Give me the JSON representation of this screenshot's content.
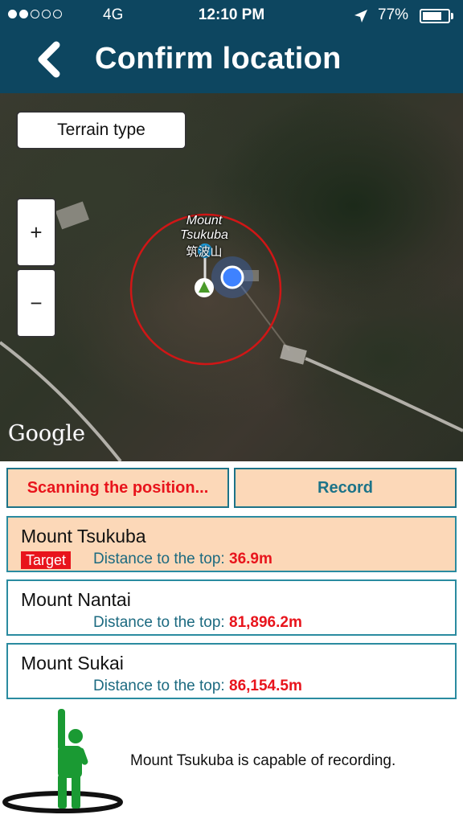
{
  "status_bar": {
    "carrier": "4G",
    "time": "12:10 PM",
    "battery_percent": "77%",
    "battery_level": 0.77,
    "signal_bars_filled": 2,
    "signal_bars_total": 5
  },
  "header": {
    "title": "Confirm location",
    "back_icon": "chevron-left-icon",
    "background_color": "#0d4660"
  },
  "map": {
    "terrain_button_label": "Terrain type",
    "zoom_in_label": "+",
    "zoom_out_label": "−",
    "place_label_line1": "Mount",
    "place_label_line2": "Tsukuba",
    "place_label_line3": "筑波山",
    "attribution": "Google",
    "map_type": "satellite"
  },
  "actions": {
    "scan_label": "Scanning the position...",
    "record_label": "Record"
  },
  "mountains": [
    {
      "name": "Mount Tsukuba",
      "badge": "Target",
      "distance_label": "Distance to the top:",
      "distance": "36.9m",
      "selected": true
    },
    {
      "name": "Mount Nantai",
      "badge": "",
      "distance_label": "Distance to the top:",
      "distance": "81,896.2m",
      "selected": false
    },
    {
      "name": "Mount Sukai",
      "badge": "",
      "distance_label": "Distance to the top:",
      "distance": "86,154.5m",
      "selected": false
    }
  ],
  "footer": {
    "message": "Mount Tsukuba is capable of recording.",
    "figure_icon": "person-raising-hand-icon"
  },
  "colors": {
    "accent": "#1c7388",
    "alert_red": "#e8141c",
    "highlight": "#fcd8b8",
    "figure_green": "#1a9a33"
  }
}
